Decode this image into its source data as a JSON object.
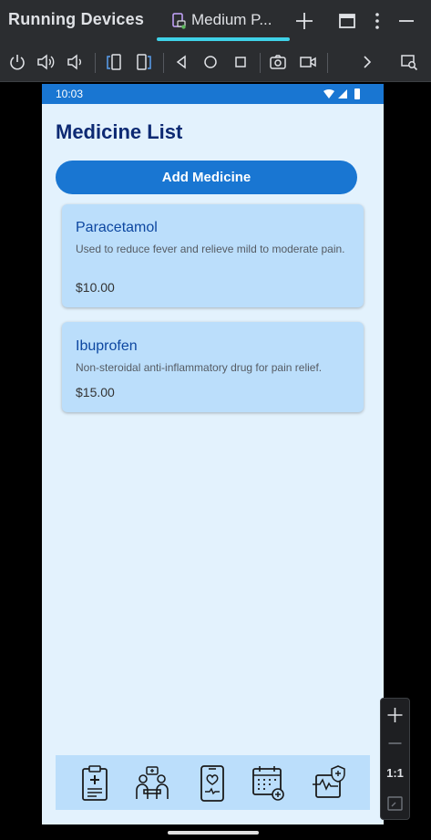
{
  "ide": {
    "panel_title": "Running Devices",
    "device_tab_label": "Medium P...",
    "icons": {
      "tab": "phone-device-icon",
      "add_tab": "plus-icon",
      "window": "window-icon",
      "more": "more-vertical-icon",
      "minimize": "minimize-icon"
    },
    "accent_color": "#3fd2e8"
  },
  "device_toolbar": {
    "icons": [
      "power-icon",
      "volume-up-icon",
      "volume-down-icon",
      "rotate-left-icon",
      "rotate-right-icon",
      "back-icon",
      "home-icon",
      "overview-icon",
      "screenshot-icon",
      "screen-record-icon",
      "chevron-right-icon",
      "device-explorer-icon"
    ]
  },
  "phone": {
    "status_bar": {
      "time": "10:03",
      "icons": [
        "wifi-icon",
        "signal-icon",
        "battery-icon"
      ],
      "color": "#1976d2"
    },
    "title": "Medicine List",
    "add_button_label": "Add Medicine",
    "medicines": [
      {
        "name": "Paracetamol",
        "description": "Used to reduce fever and relieve mild to moderate pain.",
        "price": "$10.00"
      },
      {
        "name": "Ibuprofen",
        "description": "Non-steroidal anti-inflammatory drug for pain relief.",
        "price": "$15.00"
      }
    ],
    "bottom_nav": [
      "prescription-icon",
      "consultation-icon",
      "phone-health-icon",
      "calendar-appointment-icon",
      "health-shield-icon"
    ],
    "colors": {
      "background": "#e3f2fd",
      "card": "#bbdefb",
      "primary": "#1976d2",
      "title": "#0d2a73"
    }
  },
  "zoom_controls": {
    "actual_size_label": "1:1",
    "icons": [
      "zoom-in-icon",
      "zoom-out-icon",
      "fit-screen-icon"
    ]
  }
}
